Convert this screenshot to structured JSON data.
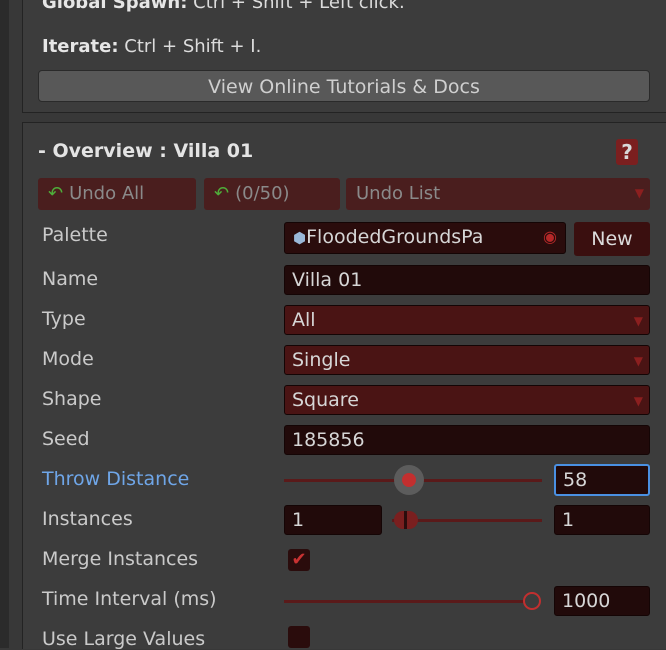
{
  "help": {
    "global_spawn_key": "Global Spawn:",
    "global_spawn_value": " Ctrl + Shift + Left click.",
    "iterate_key": "Iterate:",
    "iterate_value": " Ctrl + Shift + I."
  },
  "docs_button": "View Online Tutorials & Docs",
  "overview": {
    "title": "- Overview : Villa 01",
    "help_badge": "?",
    "undo_all": "Undo All",
    "undo_count": "(0/50)",
    "undo_list": "Undo List"
  },
  "fields": {
    "palette_label": "Palette",
    "palette_value": "FloodedGroundsPa",
    "new_button": "New",
    "name_label": "Name",
    "name_value": "Villa 01",
    "type_label": "Type",
    "type_value": "All",
    "mode_label": "Mode",
    "mode_value": "Single",
    "shape_label": "Shape",
    "shape_value": "Square",
    "seed_label": "Seed",
    "seed_value": "185856",
    "throw_label": "Throw Distance",
    "throw_value": "58",
    "instances_label": "Instances",
    "instances_min": "1",
    "instances_max": "1",
    "merge_label": "Merge Instances",
    "merge_checked": true,
    "time_label": "Time Interval (ms)",
    "time_value": "1000",
    "large_label": "Use Large Values",
    "large_checked": false
  },
  "icons": {
    "undo": "undo-arrow-icon",
    "palette": "prefab-icon",
    "object_picker": "object-picker-icon",
    "dropdown": "dropdown-arrow-icon",
    "check": "checkmark-icon"
  },
  "colors": {
    "accent_red": "#8c1f1f",
    "field_dark": "#210a0a",
    "label_blue": "#6fa6e8",
    "focus_blue": "#4a90e2"
  }
}
